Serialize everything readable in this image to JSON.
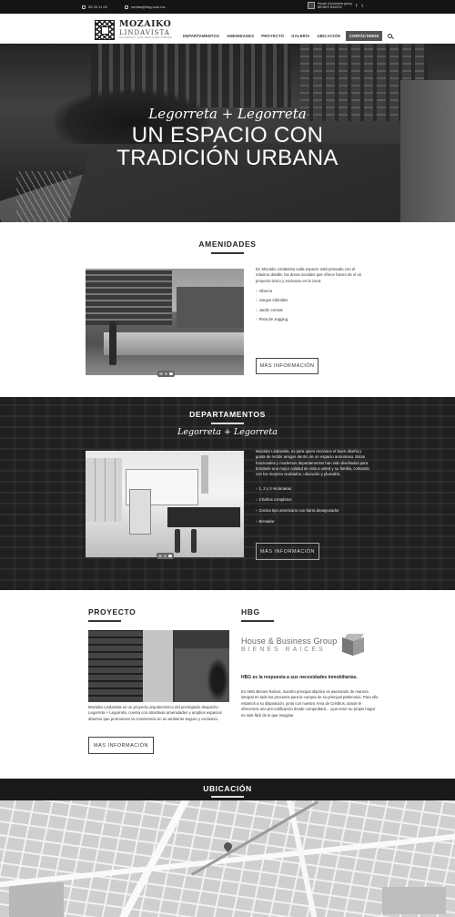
{
  "topbar": {
    "phone": "55 33 11 00",
    "email": "ventas@hbg.com.mx",
    "hbg_line1": "House & business group",
    "hbg_line2": "BIENES RAICES"
  },
  "header": {
    "logo_line1": "MOZAIKO",
    "logo_line2": "LINDAVISTA",
    "logo_tagline": "UN ESPACIO CON TRADICIÓN URBANA",
    "nav": [
      "DEPARTAMENTOS",
      "AMENIDADES",
      "PROYECTO",
      "GALERÍA",
      "UBICACIÓN"
    ],
    "cta": "CONTÁCTANOS"
  },
  "hero": {
    "subtitle": "Legorreta + Legorreta",
    "title_line1": "UN ESPACIO CON",
    "title_line2": "TRADICIÓN URBANA"
  },
  "amenidades": {
    "title": "AMENIDADES",
    "intro": "En Mozaiko Lindavista cada espacio está pensado con el máximo detalle, las áreas sociales que ofrece hacen de el un proyecto único y exclusivo en la zona.",
    "items": [
      "Alberca",
      "Juegos infantiles",
      "Jardín central",
      "Pista de Jogging"
    ],
    "button": "MÁS INFORMACIÓN"
  },
  "departamentos": {
    "title": "DEPARTAMENTOS",
    "subtitle": "Legorreta + Legorreta",
    "intro": "Mozaiko Lindavista, es para quien reconoce el buen diseño y gusta de recibir amigos dentro de un espacio armonioso. Estos funcionales y modernos departamentos han sido diseñados para brindarle una mejor calidad de vida a usted y su familia, contando con los mejores acabados, ubicación y plusvalía.",
    "items": [
      "1, 2 y 3 recámaras",
      "2 baños completos",
      "Cocina tipo americano con barra desayunador",
      "Elevador"
    ],
    "button": "MÁS INFORMACIÓN"
  },
  "proyecto": {
    "title": "PROYECTO",
    "text": "Mozaiko Lindavista es un proyecto arquitectónico del prestigiado despacho Legorreta + Legorreta, cuenta con atractivas amenidades y amplios espacios abiertos que promueven la convivencia en un ambiente seguro y exclusivo.",
    "button": "MÁS INFORMACIÓN"
  },
  "hbg": {
    "title": "HBG",
    "logo_line1": "House & Business Group",
    "logo_line2": "BIENES RAICES",
    "headline": "HBG es la respuesta a sus necesidades inmobiliarias.",
    "text": "En HBG Bienes Raíces, nuestro principal objetivo es asesorarle de manera integral en todo los procesos para la compra de su principal patrimonio. Para ello estamos a su disposición, junto con nuestro Área de Créditos, donde le ofrecemos una pre-calificación donde comprobará... ¡que tener su propio hogar es más fácil de lo que imagina!"
  },
  "ubicacion": {
    "title": "UBICACIÓN"
  }
}
